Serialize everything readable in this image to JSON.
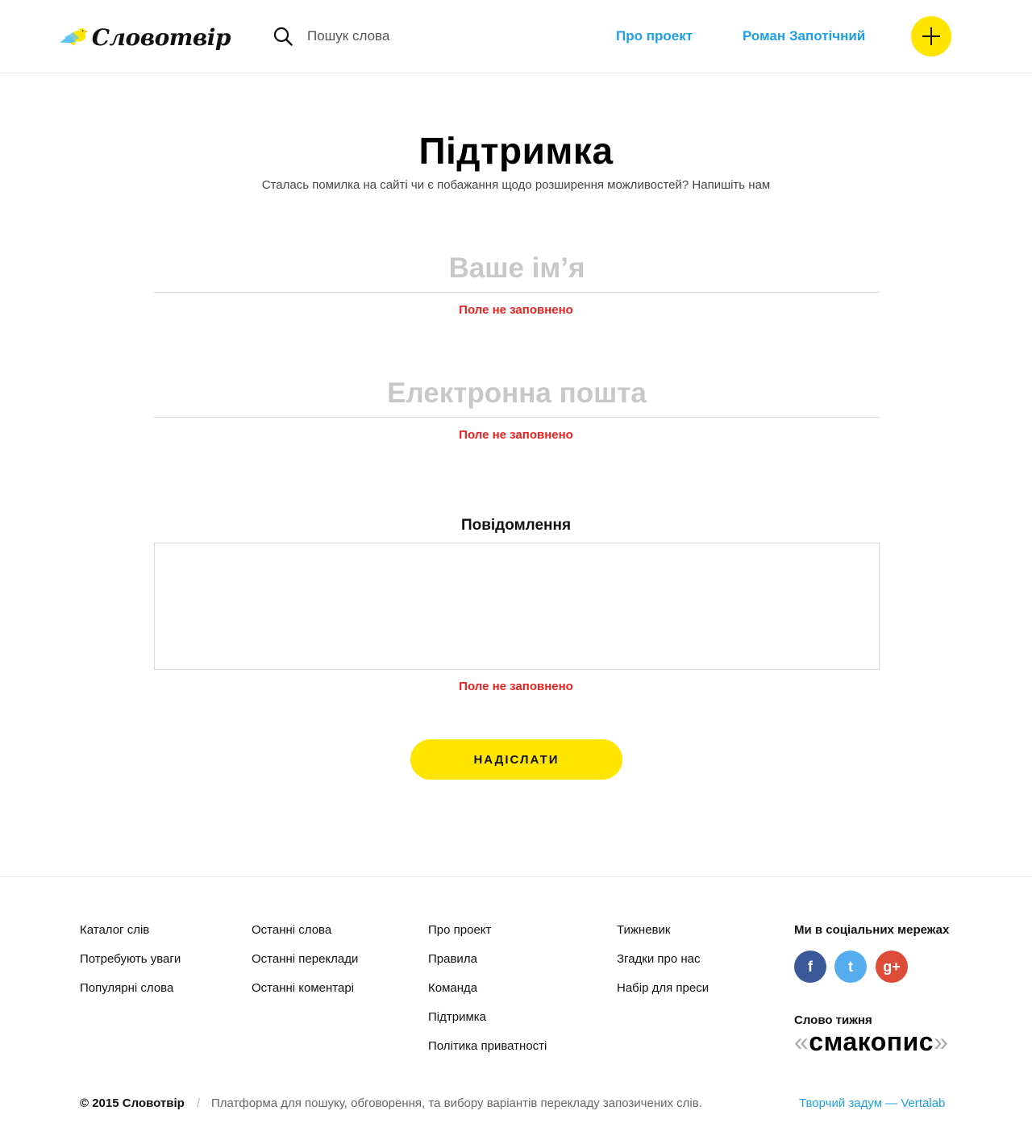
{
  "header": {
    "logo_text": "Словотвір",
    "search_placeholder": "Пошук слова",
    "nav": {
      "about": "Про проект",
      "user": "Роман Запотічний"
    },
    "add_icon": "plus-icon",
    "search_icon": "search-icon"
  },
  "main": {
    "title": "Підтримка",
    "subtitle": "Сталась помилка на сайті чи є побажання щодо розширення можливостей? Напишіть нам",
    "name_placeholder": "Ваше ім’я",
    "email_placeholder": "Електронна пошта",
    "message_label": "Повідомлення",
    "error_text": "Поле не заповнено",
    "submit_label": "НАДІСЛАТИ"
  },
  "footer": {
    "col1": [
      "Каталог слів",
      "Потребують уваги",
      "Популярні слова"
    ],
    "col2": [
      "Останні слова",
      "Останні переклади",
      "Останні коментарі"
    ],
    "col3": [
      "Про проект",
      "Правила",
      "Команда",
      "Підтримка",
      "Політика приватності"
    ],
    "col4": [
      "Тижневик",
      "Згадки про нас",
      "Набір для преси"
    ],
    "social_title": "Ми в соціальних мережах",
    "social": [
      {
        "icon": "facebook-icon",
        "glyph": "f"
      },
      {
        "icon": "twitter-icon",
        "glyph": "t"
      },
      {
        "icon": "google-plus-icon",
        "glyph": "g+"
      }
    ],
    "word_of_week_label": "Слово тижня",
    "word_of_week": "смакопис",
    "quote_open": "«",
    "quote_close": "»",
    "copyright": "© 2015 Словотвір",
    "divider": "/",
    "tagline": "Платформа для пошуку, обговорення, та вибору варіантів перекладу запозичених слів.",
    "credits": "Творчий задум — Vertalab"
  },
  "colors": {
    "accent_yellow": "#ffe500",
    "link_blue": "#1ea0e6",
    "error_red": "#e8221e",
    "facebook": "#3b5998",
    "twitter": "#55acee",
    "google_plus": "#dd4b39"
  }
}
